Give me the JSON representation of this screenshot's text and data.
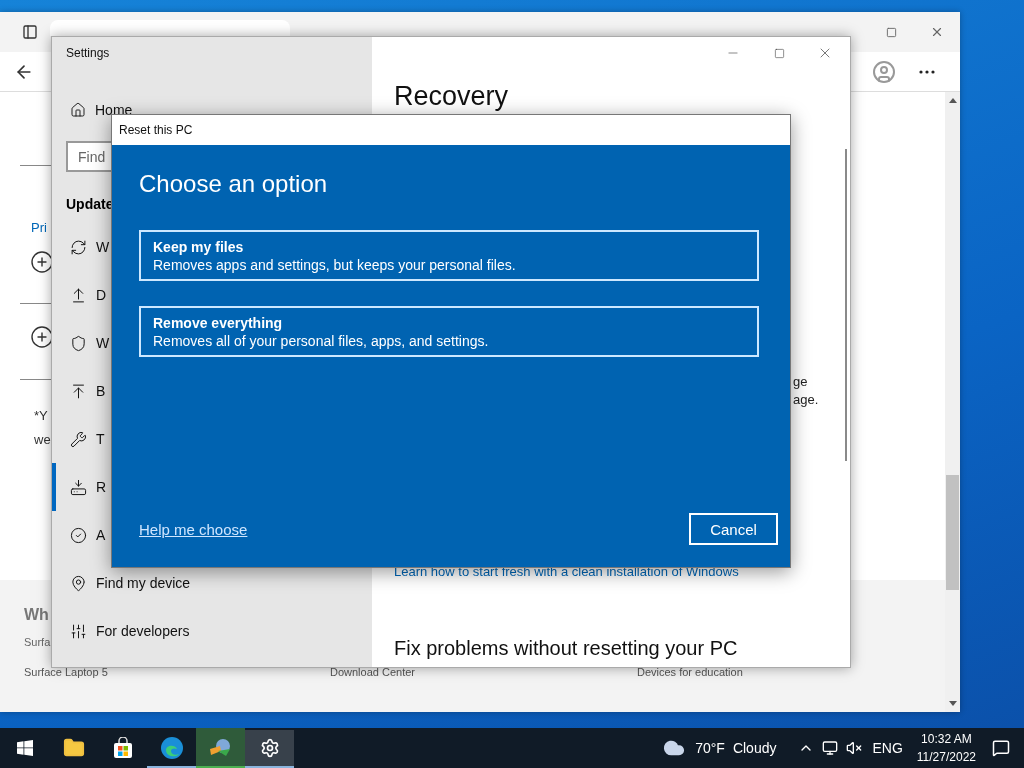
{
  "browser": {
    "content": {
      "link_fragment": "Pri",
      "note_lines": [
        "*Y",
        "we"
      ]
    },
    "footer": {
      "heading": "Wh",
      "line": "Surfa",
      "links": [
        "Surface Laptop 5",
        "Download Center",
        "Devices for education"
      ]
    }
  },
  "settings": {
    "title": "Settings",
    "nav": {
      "home": "Home",
      "search_placeholder": "Find",
      "section": "Update",
      "items": [
        {
          "label": "W",
          "kind": "sync",
          "selected": false
        },
        {
          "label": "D",
          "kind": "delivery",
          "selected": false
        },
        {
          "label": "W",
          "kind": "shield",
          "selected": false
        },
        {
          "label": "B",
          "kind": "backup",
          "selected": false
        },
        {
          "label": "T",
          "kind": "wrench",
          "selected": false
        },
        {
          "label": "R",
          "kind": "recovery",
          "selected": true
        },
        {
          "label": "A",
          "kind": "activation",
          "selected": false
        },
        {
          "label": "Find my device",
          "kind": "find",
          "selected": false
        },
        {
          "label": "For developers",
          "kind": "developer",
          "selected": false
        }
      ]
    },
    "page": {
      "title": "Recovery",
      "fragments": [
        "ge",
        "age."
      ],
      "link": "Learn how to start fresh with a clean installation of Windows",
      "heading": "Fix problems without resetting your PC"
    }
  },
  "dialog": {
    "title": "Reset this PC",
    "heading": "Choose an option",
    "options": [
      {
        "title": "Keep my files",
        "description": "Removes apps and settings, but keeps your personal files."
      },
      {
        "title": "Remove everything",
        "description": "Removes all of your personal files, apps, and settings."
      }
    ],
    "help_link": "Help me choose",
    "cancel": "Cancel"
  },
  "taskbar": {
    "apps": [
      {
        "kind": "start",
        "running": false,
        "selected": false,
        "flashing": false
      },
      {
        "kind": "explorer",
        "running": false,
        "selected": false,
        "flashing": false
      },
      {
        "kind": "store",
        "running": false,
        "selected": false,
        "flashing": false
      },
      {
        "kind": "edge",
        "running": true,
        "selected": false,
        "flashing": false
      },
      {
        "kind": "downloader",
        "running": true,
        "selected": false,
        "flashing": true
      },
      {
        "kind": "settings",
        "running": true,
        "selected": true,
        "flashing": false
      }
    ],
    "weather": {
      "temperature": "70°F",
      "condition": "Cloudy"
    },
    "language": "ENG",
    "time": "10:32 AM",
    "date": "11/27/2022"
  }
}
